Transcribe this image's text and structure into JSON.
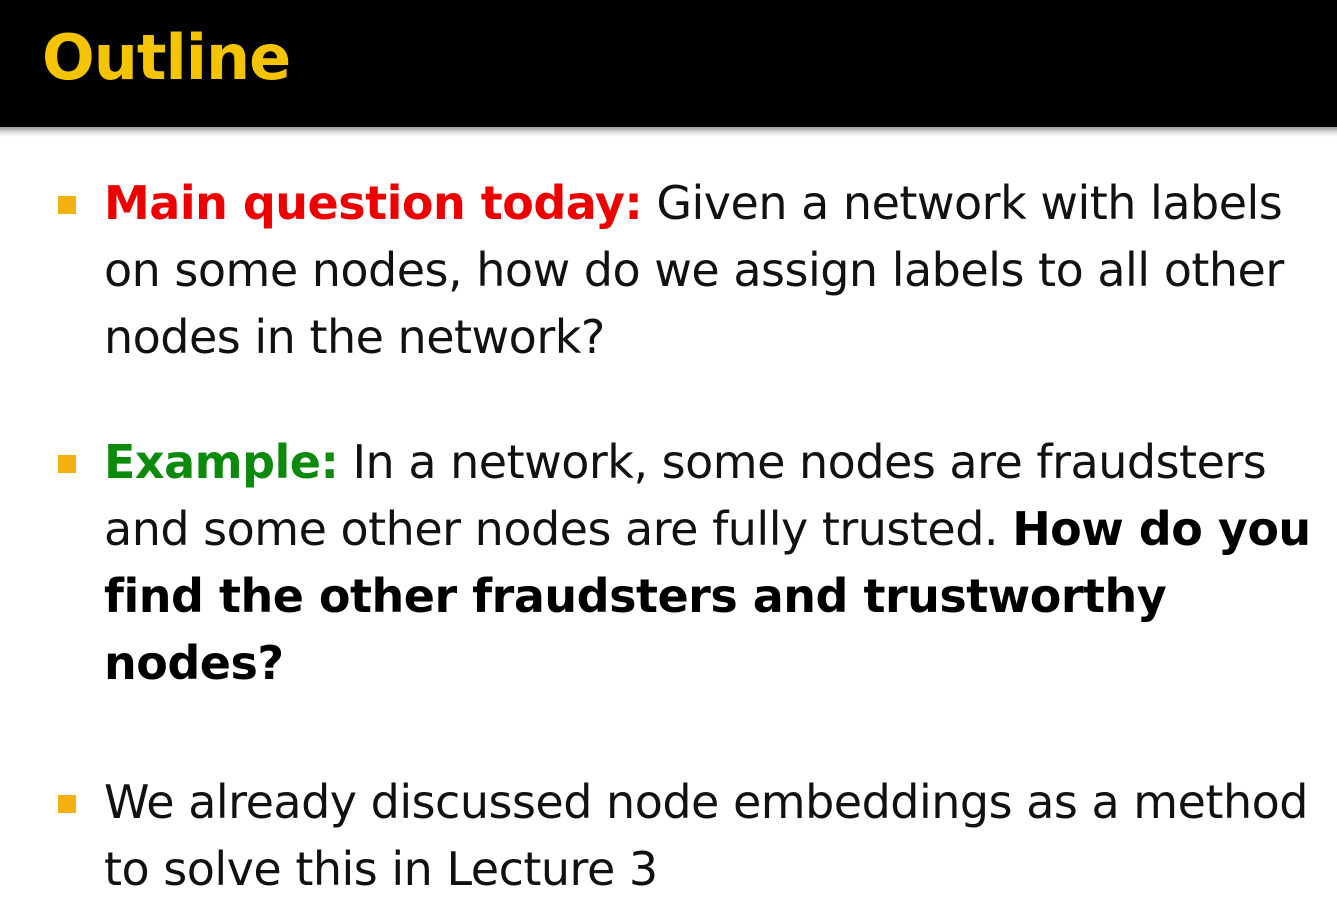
{
  "slide": {
    "title": "Outline",
    "colors": {
      "title_bar": "#000000",
      "title_text": "#f5c400",
      "bullet": "#f2b10f",
      "lead_red": "#ee0000",
      "lead_green": "#0c8a0c"
    },
    "bullets": [
      {
        "lead": "Main question today:",
        "text": " Given a network with labels on some nodes, how do we assign labels to all other nodes in the network?"
      },
      {
        "lead": "Example:",
        "text": " In a network, some nodes are fraudsters and some other nodes are fully trusted. ",
        "bold": "How do you find the other fraudsters and trustworthy nodes?"
      },
      {
        "text": "We already discussed node embeddings as a method to solve this in Lecture 3"
      }
    ]
  }
}
